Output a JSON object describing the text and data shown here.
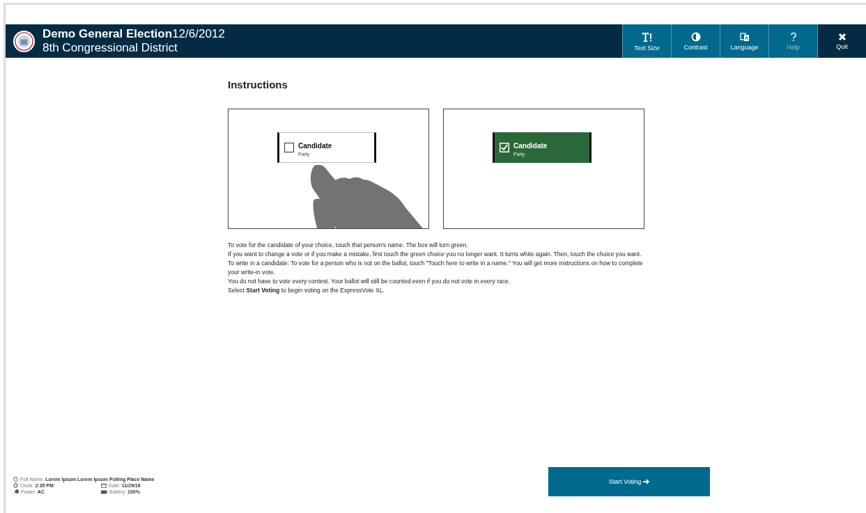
{
  "header": {
    "title": "Demo General Election",
    "date": "12/6/2012",
    "subtitle": "8th Congressional District"
  },
  "toolbar": [
    {
      "kind": "text-size",
      "label": "Text Size",
      "disabled": false
    },
    {
      "kind": "contrast",
      "label": "Contrast",
      "disabled": false
    },
    {
      "kind": "language",
      "label": "Language",
      "disabled": false
    },
    {
      "kind": "help",
      "label": "Help",
      "disabled": true
    },
    {
      "kind": "quit",
      "label": "Quit",
      "disabled": false
    }
  ],
  "instructions": {
    "title": "Instructions",
    "examples": [
      {
        "candidate": "Candidate",
        "party": "Party",
        "checked": false
      },
      {
        "candidate": "Candidate",
        "party": "Party",
        "checked": true
      }
    ],
    "paragraphs": [
      "To vote for the candidate of your choice, touch that person's name. The box will turn green.",
      "If you want to change a vote or if you make a mistake, first touch the green choice you no longer want. It turns white again. Then, touch the choice you want.",
      "To write in a candidate: To vote for a person who is not on the ballot, touch \"Touch here to write in a name.\" You will get more instructions on how to complete your write-in vote.",
      "You do not have to vote every contest. Your ballot will still be counted even if you do not vote in every race.",
      "Select **Start Voting** to begin voting on the ExpressVote XL."
    ]
  },
  "status": [
    {
      "kind": "poll",
      "label": "Poll Name:",
      "value": "Lorem Ipsum Lorem Ipsum Polling Place Name"
    },
    {
      "kind": "clock",
      "label": "Clock:",
      "value": "2:35 PM"
    },
    {
      "kind": "date",
      "label": "Date:",
      "value": "11/29/16"
    },
    {
      "kind": "power",
      "label": "Power:",
      "value": "AC"
    },
    {
      "kind": "battery",
      "label": "Battery:",
      "value": "100%"
    }
  ],
  "start_button": {
    "label": "Start Voting"
  }
}
